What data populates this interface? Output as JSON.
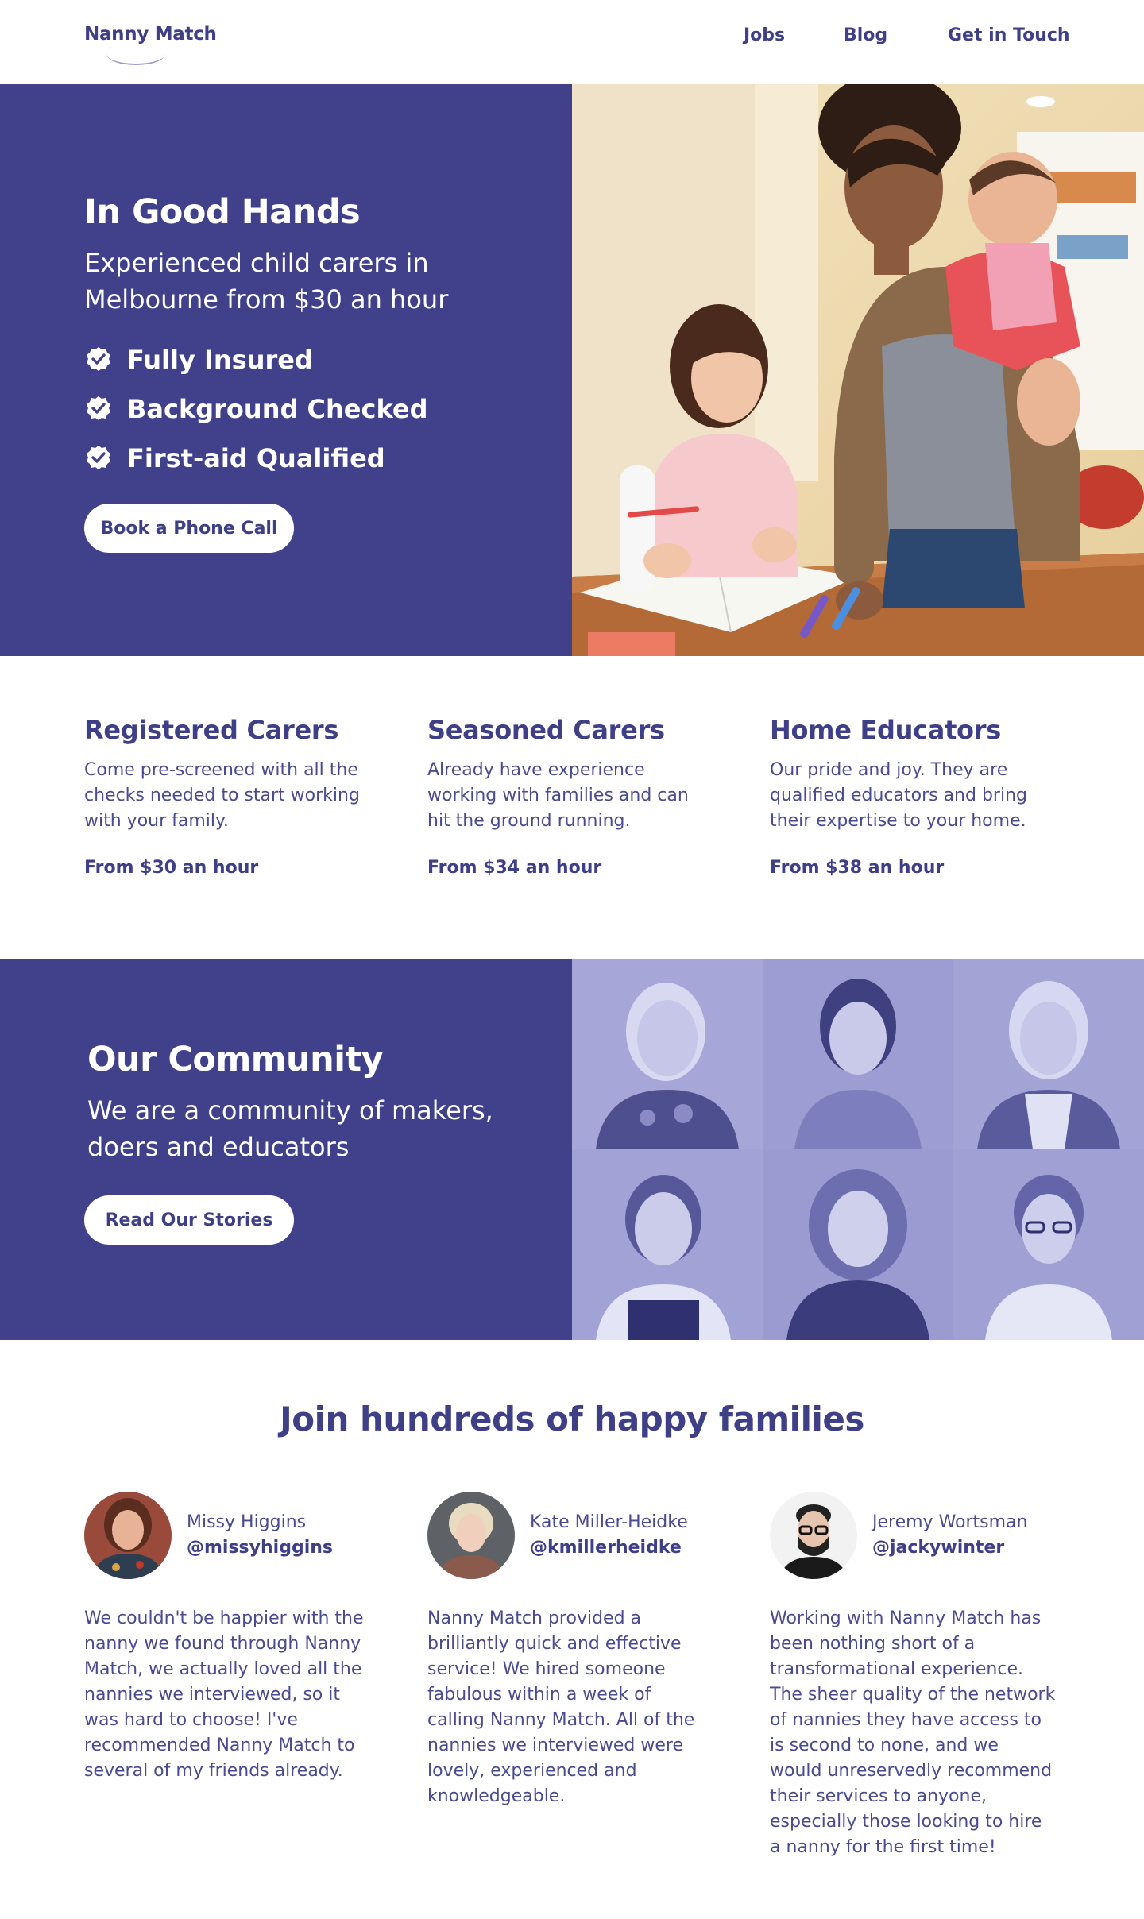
{
  "header": {
    "logo": "Nanny Match",
    "nav": {
      "jobs": "Jobs",
      "blog": "Blog",
      "contact": "Get in Touch"
    }
  },
  "hero": {
    "title": "In Good Hands",
    "subtitle": "Experienced child carers in Melbourne from $30 an hour",
    "features": [
      "Fully Insured",
      "Background Checked",
      "First-aid Qualified"
    ],
    "cta": "Book a Phone Call"
  },
  "carers": [
    {
      "title": "Registered Carers",
      "desc": "Come pre-screened with all the checks needed to start working with your family.",
      "price": "From $30 an hour"
    },
    {
      "title": "Seasoned Carers",
      "desc": "Already have experience working with families and can hit the ground running.",
      "price": "From $34 an hour"
    },
    {
      "title": "Home Educators",
      "desc": "Our pride and joy. They are qualified educators and bring their expertise to your home.",
      "price": "From $38 an hour"
    }
  ],
  "community": {
    "title": "Our Community",
    "subtitle": "We are a community of makers, doers and educators",
    "cta": "Read Our Stories"
  },
  "testimonials": {
    "title": "Join hundreds of happy families",
    "items": [
      {
        "name": "Missy Higgins",
        "handle": "@missyhiggins",
        "quote": "We couldn't be happier with the nanny we found through Nanny Match, we actually loved all the nannies we interviewed, so it was hard to choose! I've recommended Nanny Match to several of my friends already."
      },
      {
        "name": "Kate Miller-Heidke",
        "handle": "@kmillerheidke",
        "quote": "Nanny Match provided a brilliantly quick and effective service! We hired someone fabulous within a week of calling Nanny Match. All of the nannies we interviewed were lovely, experienced and knowledgeable."
      },
      {
        "name": "Jeremy Wortsman",
        "handle": "@jackywinter",
        "quote": "Working with Nanny Match has been nothing short of a transformational experience. The sheer quality of the network of nannies they have access to is second to none, and we would unreservedly recommend their services to anyone, especially those looking to hire a nanny for the first time!"
      }
    ]
  },
  "colors": {
    "brand": "#40418a",
    "text": "#3f3f88",
    "white": "#ffffff"
  }
}
